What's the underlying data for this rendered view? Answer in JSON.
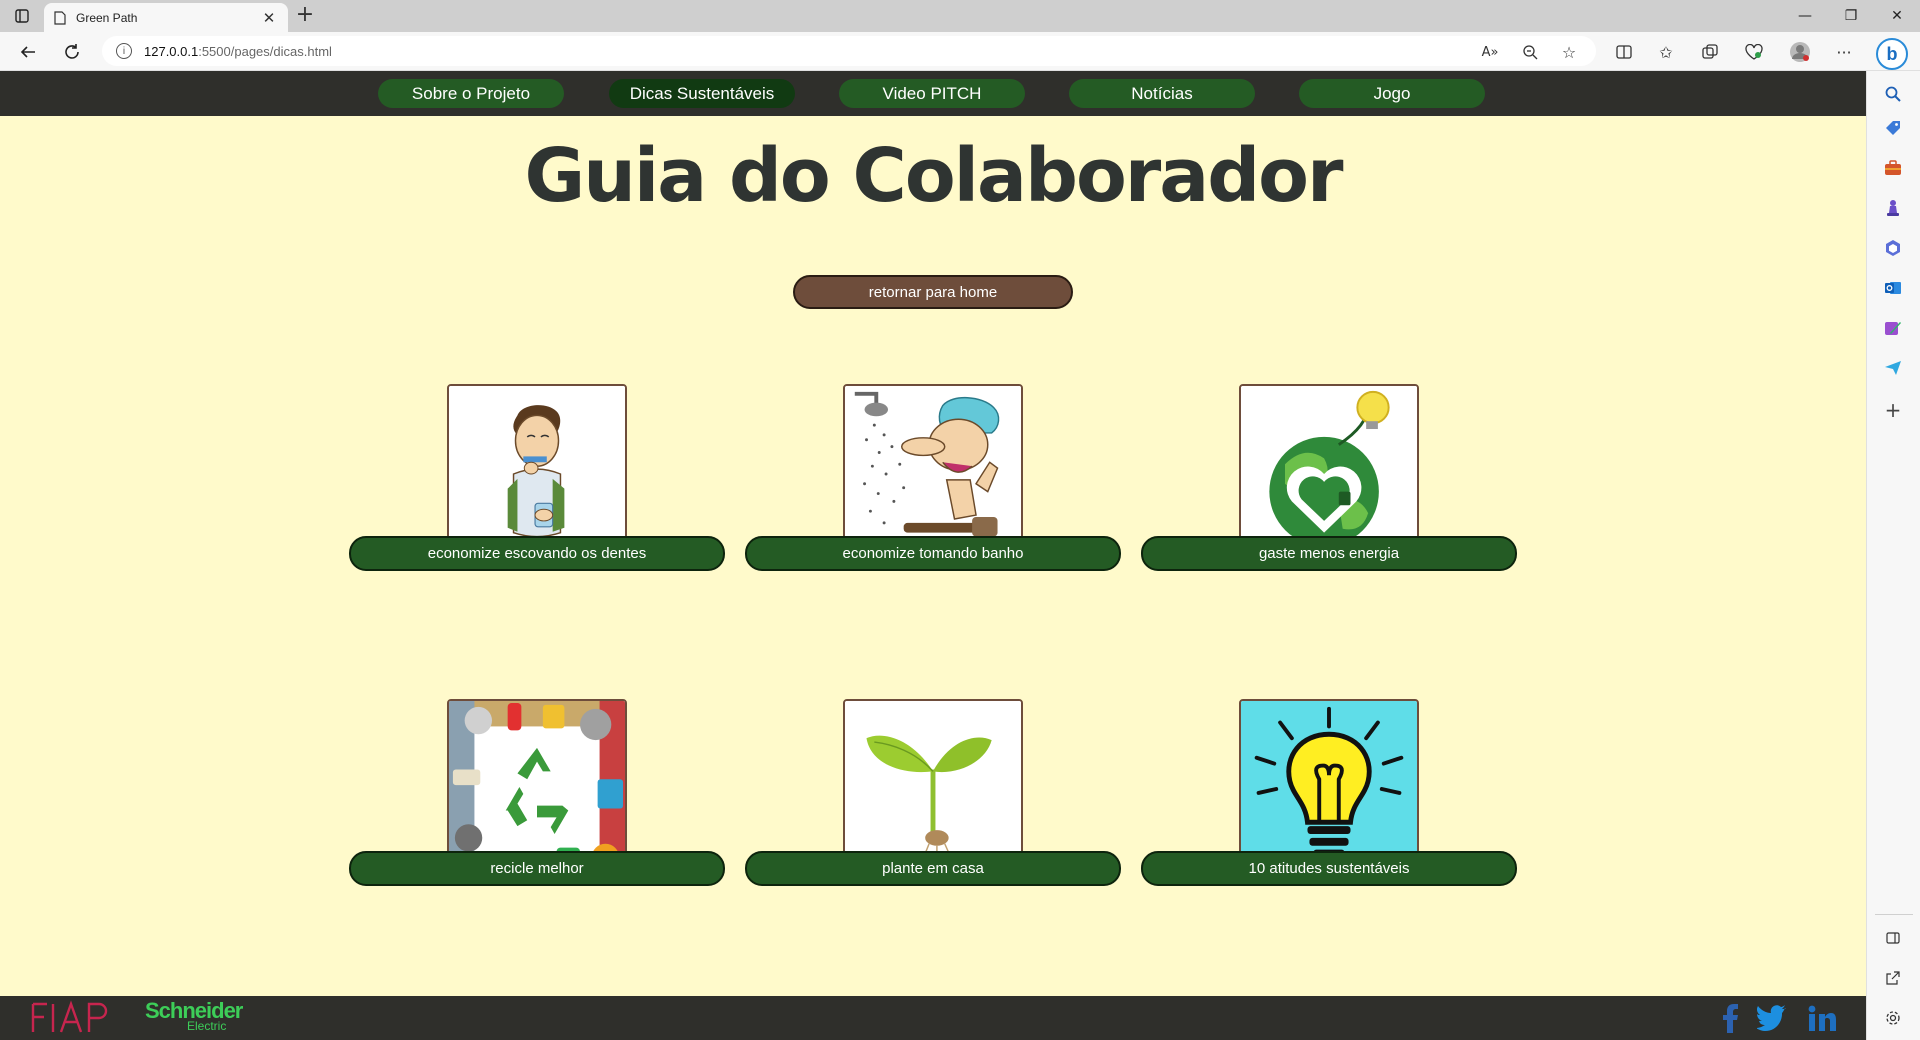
{
  "browser": {
    "tab_title": "Green Path",
    "url_host": "127.0.0.1",
    "url_path": ":5500/pages/dicas.html"
  },
  "nav": {
    "items": [
      {
        "label": "Sobre o Projeto"
      },
      {
        "label": "Dicas Sustentáveis"
      },
      {
        "label": "Video PITCH"
      },
      {
        "label": "Notícias"
      },
      {
        "label": "Jogo"
      }
    ],
    "active": "Dicas Sustentáveis"
  },
  "main": {
    "title": "Guia do Colaborador",
    "home_button": "retornar para home",
    "cards": [
      {
        "label": "economize escovando os dentes",
        "icon": "brushing-teeth-image"
      },
      {
        "label": "economize tomando banho",
        "icon": "shower-image"
      },
      {
        "label": "gaste menos energia",
        "icon": "green-energy-globe-image"
      },
      {
        "label": "recicle melhor",
        "icon": "recycle-image"
      },
      {
        "label": "plante em casa",
        "icon": "sprout-image"
      },
      {
        "label": "10 atitudes sustentáveis",
        "icon": "lightbulb-image"
      }
    ]
  },
  "footer": {
    "logo_fiap": "FIAP",
    "logo_schneider": "Schneider",
    "logo_schneider_sub": "Electric",
    "social": [
      "facebook-icon",
      "twitter-icon",
      "linkedin-icon"
    ]
  },
  "colors": {
    "page_background": "#fffacb",
    "nav_background": "#2f2f2b",
    "button_green": "#245b24",
    "active_green": "#113a12",
    "home_button": "#6e4d3b",
    "title": "#2f3432"
  }
}
